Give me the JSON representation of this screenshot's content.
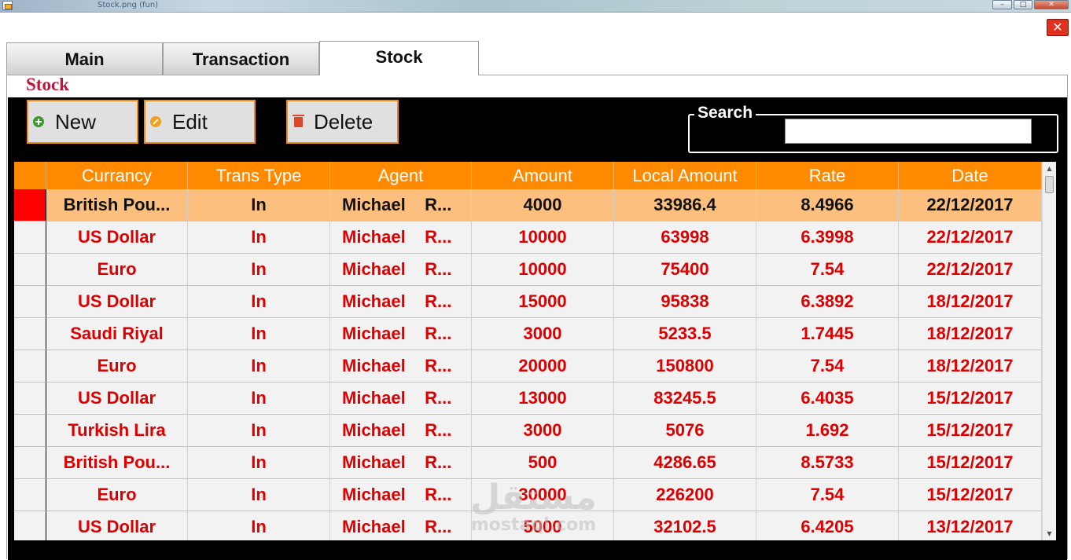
{
  "window": {
    "title": "Stock.png (fun)",
    "min_glyph": "–",
    "max_glyph": "□",
    "close_glyph": "✕"
  },
  "close_button_glyph": "✕",
  "tabs": [
    {
      "label": "Main",
      "active": false
    },
    {
      "label": "Transaction",
      "active": false
    },
    {
      "label": "Stock",
      "active": true
    }
  ],
  "section_title": "Stock",
  "toolbar": {
    "new_label": "New",
    "edit_label": "Edit",
    "delete_label": "Delete",
    "icons": {
      "new": "plus-circle-icon",
      "edit": "pencil-icon",
      "delete": "trash-icon"
    }
  },
  "search": {
    "label": "Search",
    "value": ""
  },
  "grid": {
    "columns": [
      "Currancy",
      "Trans Type",
      "Agent",
      "Amount",
      "Local Amount",
      "Rate",
      "Date"
    ],
    "selected_row": 0,
    "rows": [
      [
        "British Pou...",
        "In",
        "Michael    R...",
        "4000",
        "33986.4",
        "8.4966",
        "22/12/2017"
      ],
      [
        "US Dollar",
        "In",
        "Michael    R...",
        "10000",
        "63998",
        "6.3998",
        "22/12/2017"
      ],
      [
        "Euro",
        "In",
        "Michael    R...",
        "10000",
        "75400",
        "7.54",
        "22/12/2017"
      ],
      [
        "US Dollar",
        "In",
        "Michael    R...",
        "15000",
        "95838",
        "6.3892",
        "18/12/2017"
      ],
      [
        "Saudi Riyal",
        "In",
        "Michael    R...",
        "3000",
        "5233.5",
        "1.7445",
        "18/12/2017"
      ],
      [
        "Euro",
        "In",
        "Michael    R...",
        "20000",
        "150800",
        "7.54",
        "18/12/2017"
      ],
      [
        "US Dollar",
        "In",
        "Michael    R...",
        "13000",
        "83245.5",
        "6.4035",
        "15/12/2017"
      ],
      [
        "Turkish Lira",
        "In",
        "Michael    R...",
        "3000",
        "5076",
        "1.692",
        "15/12/2017"
      ],
      [
        "British Pou...",
        "In",
        "Michael    R...",
        "500",
        "4286.65",
        "8.5733",
        "15/12/2017"
      ],
      [
        "Euro",
        "In",
        "Michael    R...",
        "30000",
        "226200",
        "7.54",
        "15/12/2017"
      ],
      [
        "US Dollar",
        "In",
        "Michael    R...",
        "5000",
        "32102.5",
        "6.4205",
        "13/12/2017"
      ]
    ]
  },
  "watermark": {
    "arabic": "مستقل",
    "latin": "mostaql.com"
  },
  "colors": {
    "header_bg": "#ff8a00",
    "row_text": "#dd0000",
    "selected_row_bg": "#fdbf7e",
    "selected_marker": "#ff0000",
    "panel_bg": "#000000",
    "section_title": "#c0143c"
  }
}
